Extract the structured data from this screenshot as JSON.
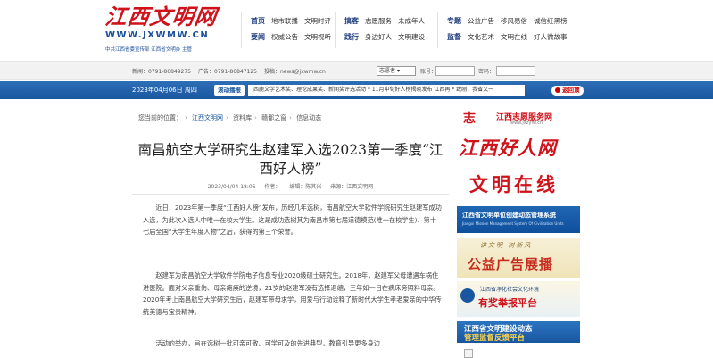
{
  "header": {
    "logo_text": "江西文明网",
    "logo_url": "WWW.JXWMW.CN",
    "logo_sub": "中共江西省委宣传部 江西省文明办 主管",
    "nav_groups": [
      {
        "rows": [
          {
            "key": "首页",
            "items": [
              "地市联播",
              "文明时评"
            ]
          },
          {
            "key": "要闻",
            "items": [
              "权威公告",
              "文明视听"
            ]
          }
        ]
      },
      {
        "rows": [
          {
            "key": "搞客",
            "items": [
              "志愿服务",
              "未成年人"
            ]
          },
          {
            "key": "践行",
            "items": [
              "身边好人",
              "文明建设"
            ]
          }
        ]
      },
      {
        "rows": [
          {
            "key": "专题",
            "items": [
              "公益广告",
              "移风易俗",
              "诚信红黑榜"
            ]
          },
          {
            "key": "监督",
            "items": [
              "文化艺术",
              "文明在线",
              "好人微故事"
            ]
          }
        ]
      }
    ]
  },
  "topbar": {
    "tel1": "新闻：0791-86849275",
    "tel2": "广告：0791-86847125",
    "email": "投稿：news@jxwmw.cn",
    "select_value": "志愿者",
    "account_label": "账号：",
    "password_label": "密码："
  },
  "bluebar": {
    "date": "2023年04月06日 周四",
    "ticker_label": "滚动播报",
    "ticker_text": "西鹿文学艺术奖、理论成果奖、新闻奖评选活动 * 11月中旬好人榜揭晓发布 江西再 * 致刚，我省又一",
    "return_label": "返回顶"
  },
  "breadcrumb": {
    "prefix": "您当前的位置：",
    "items": [
      "江西文明网",
      "资料库",
      "赣鄱之窗",
      "信息动态"
    ]
  },
  "article": {
    "title": "南昌航空大学研究生赵建军入选2023第一季度“江西好人榜”",
    "date": "2023/04/04 18:06",
    "author": "作者：",
    "editor": "编辑：陈其兴",
    "source": "来源：江西文明网",
    "paragraphs": [
      "近日，2023年第一季度“江西好人榜”发布，历经几年选树，南昌航空大学软件学院研究生赵建军成功入选，为此次入选人中唯一在校大学生。这是成功选树其为南昌市第七届道德模范(唯一在校学生)、第十七届全国“大学生年度人物”之后，获得的第三个荣誉。",
      "赵建军为南昌航空大学软件学院电子信息专业2020级硕士研究生。2018年，赵建军父母遭遇车祸住进医院。面对父亲重伤、母亲瘫痪的逆境，21岁的赵建军没有选择退缩，三年如一日在病床旁照料母亲。2020年考上南昌航空大学研究生后，赵建军带母求学，用爱与行动诠释了新时代大学生孝老爱亲的中华传统美德与宝贵精神。",
      "活动的举办，旨在选树一批可亲可敬、可学可及的先进典型，教育引导更多身边"
    ]
  },
  "sidebar": {
    "ad1_emblem": "志",
    "ad1_title": "江西志愿服务网",
    "ad1_url": "www.jxzyfw.cn",
    "ad2_title": "江西好人网",
    "ad3_title": "文明在线",
    "ad4_title": "江西省文明单位创建动态管理系统",
    "ad4_sub": "Jiangxi Mission Management System Of Civilization Units",
    "ad5_slogan": "讲文明 树新风",
    "ad5_title": "公益广告展播",
    "ad6_sub": "江西省净化社会文化环境",
    "ad6_title": "有奖举报平台",
    "ad7_line1": "江西省文明建设动态",
    "ad7_line2": "管理监督反馈平台"
  },
  "colors": {
    "brand_red": "#d0121b",
    "brand_blue": "#1a56a0"
  }
}
